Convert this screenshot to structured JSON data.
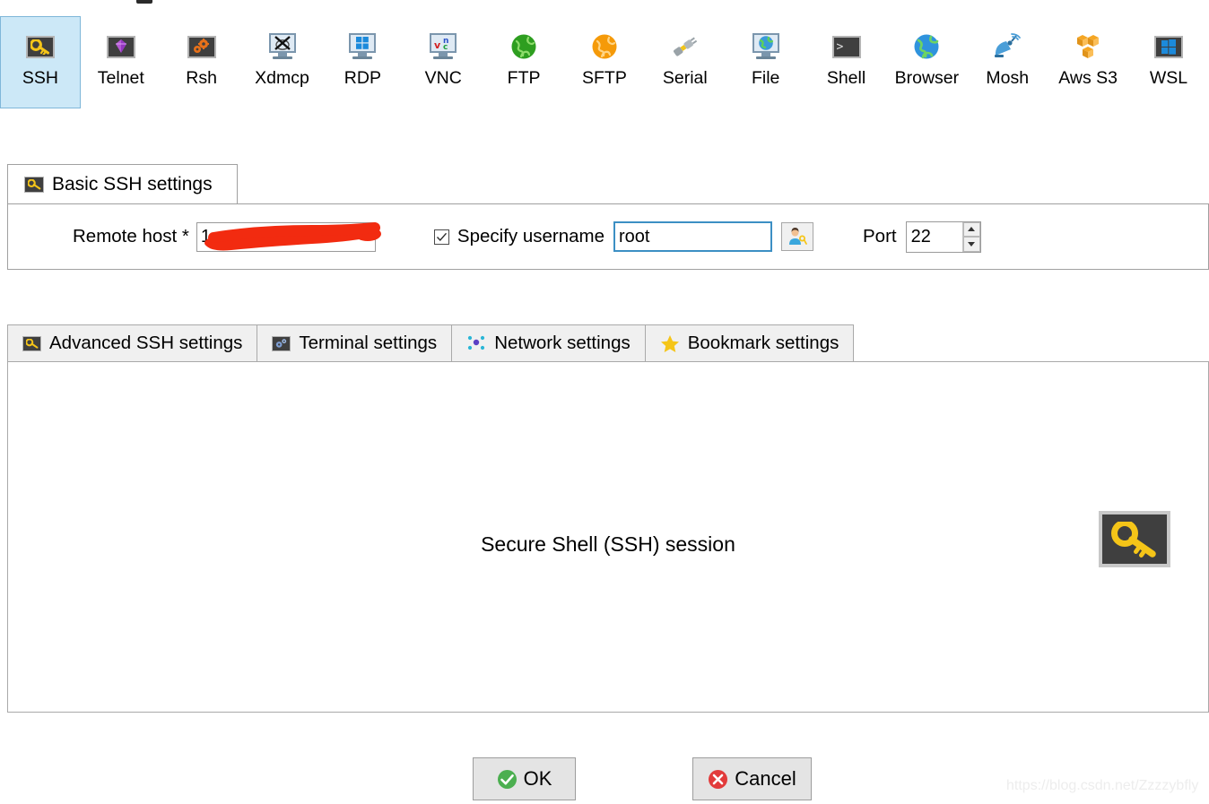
{
  "session_types": [
    {
      "label": "SSH",
      "icon": "key-icon",
      "selected": true
    },
    {
      "label": "Telnet",
      "icon": "telnet-gem-icon",
      "selected": false
    },
    {
      "label": "Rsh",
      "icon": "gears-icon",
      "selected": false
    },
    {
      "label": "Xdmcp",
      "icon": "x-monitor-icon",
      "selected": false
    },
    {
      "label": "RDP",
      "icon": "windows-monitor-icon",
      "selected": false
    },
    {
      "label": "VNC",
      "icon": "vnc-monitor-icon",
      "selected": false
    },
    {
      "label": "FTP",
      "icon": "green-globe-icon",
      "selected": false
    },
    {
      "label": "SFTP",
      "icon": "orange-globe-icon",
      "selected": false
    },
    {
      "label": "Serial",
      "icon": "plug-icon",
      "selected": false
    },
    {
      "label": "File",
      "icon": "file-monitor-icon",
      "selected": false
    },
    {
      "label": "Shell",
      "icon": "terminal-prompt-icon",
      "selected": false
    },
    {
      "label": "Browser",
      "icon": "blue-globe-icon",
      "selected": false
    },
    {
      "label": "Mosh",
      "icon": "satellite-dish-icon",
      "selected": false
    },
    {
      "label": "Aws S3",
      "icon": "aws-cubes-icon",
      "selected": false
    },
    {
      "label": "WSL",
      "icon": "windows-logo-icon",
      "selected": false
    }
  ],
  "basic_settings": {
    "tab_title": "Basic SSH settings",
    "tab_icon": "key-icon",
    "remote_host_label": "Remote host *",
    "remote_host_value": "1",
    "remote_host_redacted": true,
    "specify_username_label": "Specify username",
    "specify_username_checked": true,
    "username_value": "root",
    "username_placeholder": "",
    "user_key_button_icon": "user-key-icon",
    "port_label": "Port",
    "port_value": "22"
  },
  "sub_tabs": [
    {
      "label": "Advanced SSH settings",
      "icon": "key-icon",
      "active": false
    },
    {
      "label": "Terminal settings",
      "icon": "terminal-gear-icon",
      "active": false
    },
    {
      "label": "Network settings",
      "icon": "network-dots-icon",
      "active": false
    },
    {
      "label": "Bookmark settings",
      "icon": "star-icon",
      "active": false
    }
  ],
  "panel": {
    "caption": "Secure Shell (SSH) session",
    "big_icon": "key-icon"
  },
  "buttons": {
    "ok_label": "OK",
    "ok_icon": "green-check-icon",
    "cancel_label": "Cancel",
    "cancel_icon": "red-x-icon"
  },
  "watermark": "https://blog.csdn.net/Zzzzybfly",
  "colors": {
    "selected_tab_bg": "#cce8f7",
    "selected_tab_border": "#7fb7d9",
    "key_yellow": "#f5c518",
    "icon_dark": "#3f3f3f",
    "redaction_red": "#f22b10",
    "focus_blue": "#3c8fc4",
    "ok_green": "#4caf50",
    "cancel_red": "#e23b3b"
  }
}
